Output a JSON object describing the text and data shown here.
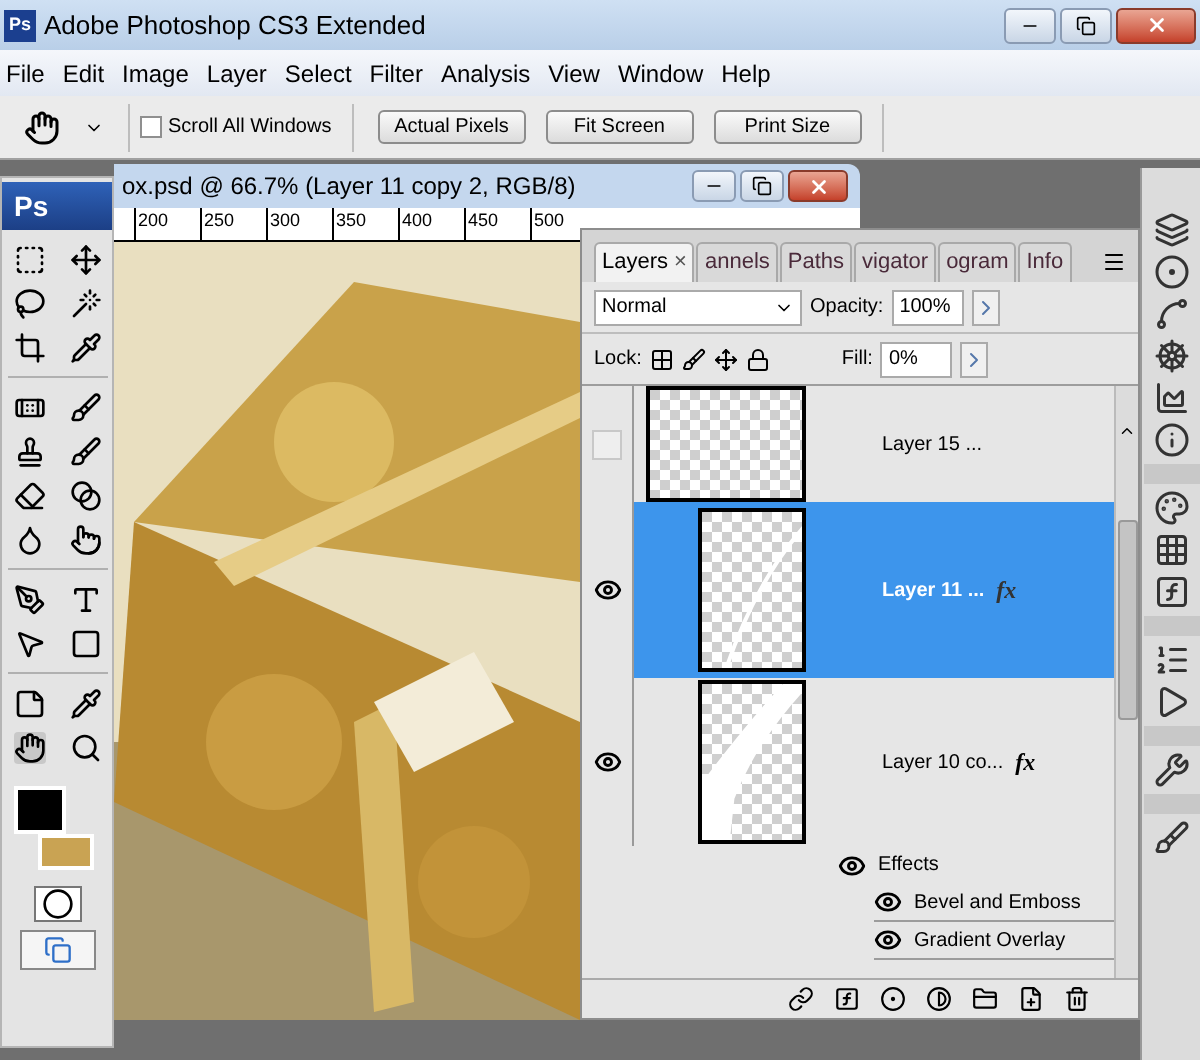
{
  "window": {
    "logo": "Ps",
    "title": "Adobe Photoshop CS3 Extended"
  },
  "menu": [
    "File",
    "Edit",
    "Image",
    "Layer",
    "Select",
    "Filter",
    "Analysis",
    "View",
    "Window",
    "Help"
  ],
  "options_bar": {
    "scroll_all": {
      "label": "Scroll All Windows",
      "checked": false
    },
    "buttons": [
      "Actual Pixels",
      "Fit Screen",
      "Print Size"
    ]
  },
  "toolbox": {
    "logo": "Ps",
    "swatches": [
      {
        "kind": "foreground",
        "color": "#000000"
      },
      {
        "kind": "background",
        "color": "#c9a353"
      }
    ]
  },
  "document": {
    "title": "ox.psd @ 66.7% (Layer 11 copy 2, RGB/8)",
    "ruler": [
      "200",
      "250",
      "300",
      "350",
      "400",
      "450",
      "500"
    ],
    "kind": "picture"
  },
  "layers_panel": {
    "tabs": [
      {
        "label": "Layers",
        "selected": true
      },
      {
        "label": "annels",
        "selected": false
      },
      {
        "label": "Paths",
        "selected": false
      },
      {
        "label": "vigator",
        "selected": false
      },
      {
        "label": "ogram",
        "selected": false
      },
      {
        "label": "Info",
        "selected": false
      }
    ],
    "close_label": "×",
    "blend_mode": "Normal",
    "opacity_label": "Opacity:",
    "opacity": "100%",
    "lock_label": "Lock:",
    "fill_label": "Fill:",
    "fill": "0%",
    "layers": [
      {
        "name": "Layer 15 ...",
        "visible": false,
        "selected": false
      },
      {
        "name": "Layer 11 ...",
        "visible": true,
        "selected": true,
        "fx": "fx"
      },
      {
        "name": "Layer 10 co...",
        "visible": true,
        "selected": false,
        "fx": "fx",
        "children": [
          {
            "name": "Effects",
            "visible": true,
            "children": [
              {
                "name": "Bevel and Emboss",
                "visible": true
              },
              {
                "name": "Gradient Overlay",
                "visible": true
              }
            ]
          }
        ]
      }
    ]
  }
}
